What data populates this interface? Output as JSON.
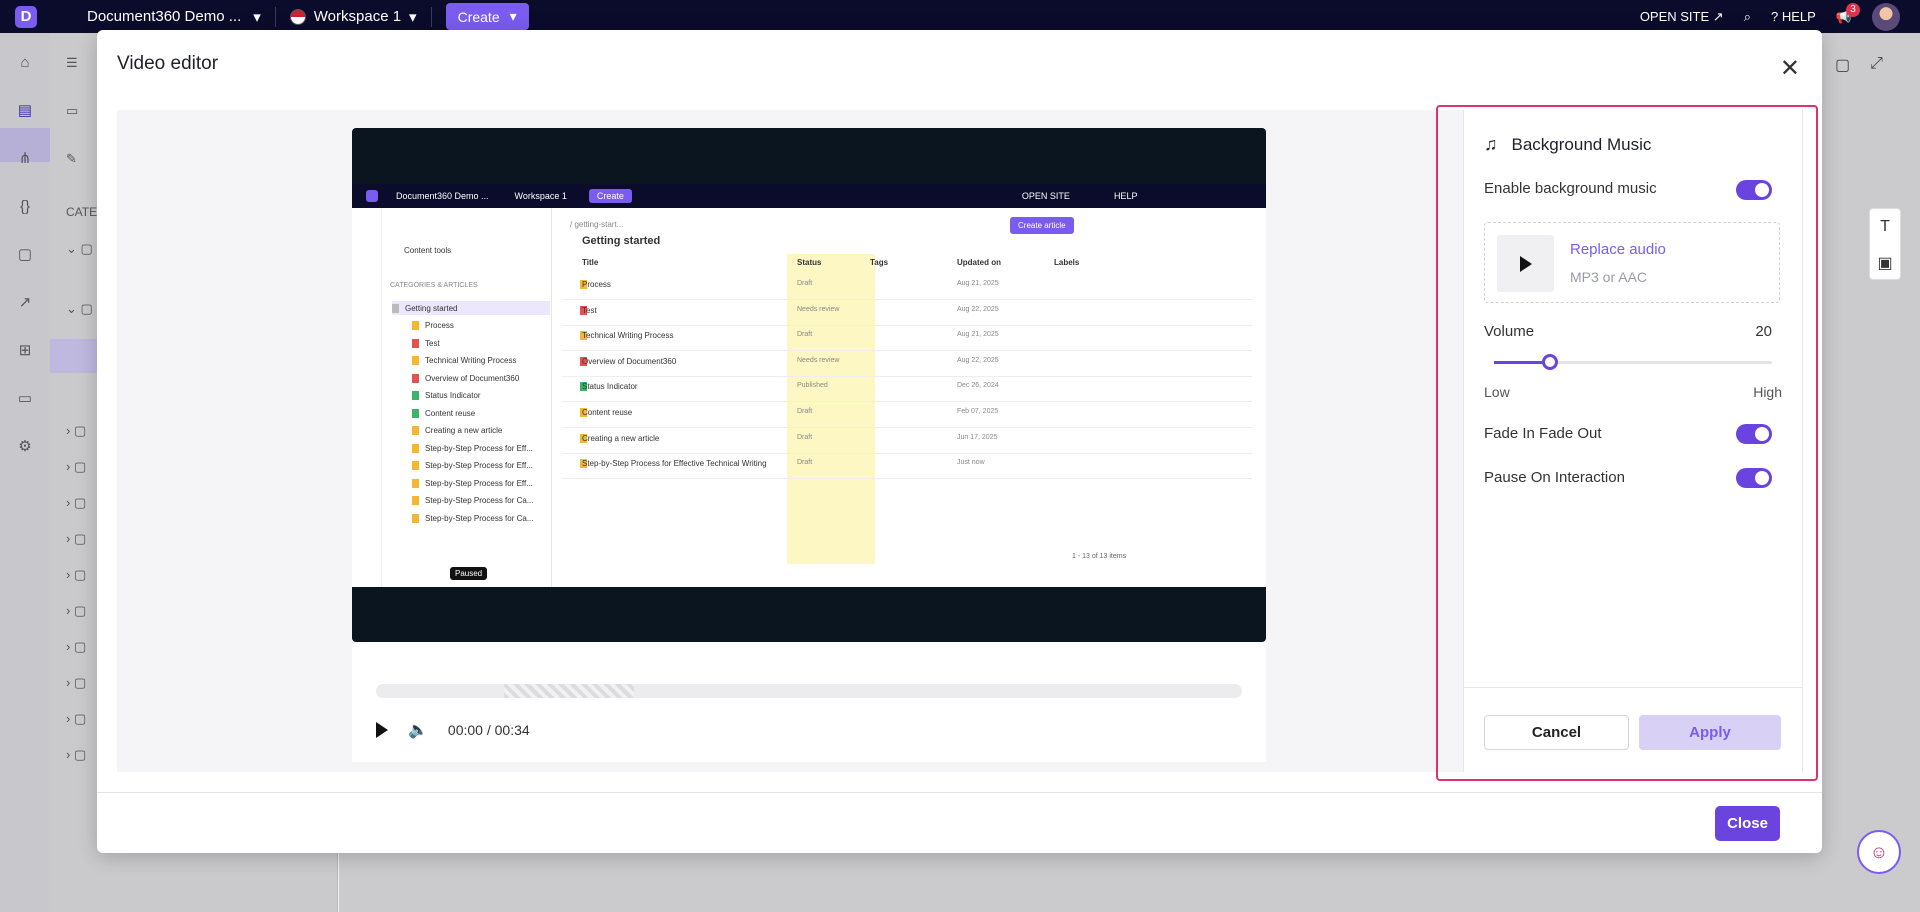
{
  "topbar": {
    "project": "Document360 Demo ...",
    "workspace": "Workspace 1",
    "create_label": "Create",
    "open_site": "OPEN SITE",
    "help": "HELP",
    "notification_count": "3"
  },
  "tree_partial": {
    "categories_label": "CATE"
  },
  "modal": {
    "title": "Video editor",
    "close_label": "Close",
    "time_display": "00:00 / 00:34"
  },
  "video_frame": {
    "project": "Document360 Demo ...",
    "workspace": "Workspace 1",
    "create": "Create",
    "open_site": "OPEN SITE",
    "help": "HELP",
    "breadcrumb": "/ getting-start...",
    "page_title": "Getting started",
    "create_article": "Create article",
    "content_tools": "Content tools",
    "categories_label": "CATEGORIES & ARTICLES",
    "tree_items": [
      {
        "label": "Getting started",
        "color": "folder"
      },
      {
        "label": "Process",
        "color": "o"
      },
      {
        "label": "Test",
        "color": "r"
      },
      {
        "label": "Technical Writing Process",
        "color": "o"
      },
      {
        "label": "Overview of Document360",
        "color": "r"
      },
      {
        "label": "Status Indicator",
        "color": "g"
      },
      {
        "label": "Content reuse",
        "color": "g"
      },
      {
        "label": "Creating a new article",
        "color": "o"
      },
      {
        "label": "Step-by-Step Process for Eff...",
        "color": "o"
      },
      {
        "label": "Step-by-Step Process for Eff...",
        "color": "o"
      },
      {
        "label": "Step-by-Step Process for Eff...",
        "color": "o"
      },
      {
        "label": "Step-by-Step Process for Ca...",
        "color": "o"
      },
      {
        "label": "Step-by-Step Process for Ca...",
        "color": "o"
      }
    ],
    "columns": [
      "Title",
      "Status",
      "Tags",
      "Updated on",
      "Labels"
    ],
    "rows": [
      {
        "title": "Process",
        "status": "Draft",
        "updated": "Aug 21, 2025",
        "color": "o"
      },
      {
        "title": "Test",
        "status": "Needs review",
        "updated": "Aug 22, 2025",
        "color": "r"
      },
      {
        "title": "Technical Writing Process",
        "status": "Draft",
        "updated": "Aug 21, 2025",
        "color": "o"
      },
      {
        "title": "Overview of Document360",
        "status": "Needs review",
        "updated": "Aug 22, 2025",
        "color": "r"
      },
      {
        "title": "Status Indicator",
        "status": "Published",
        "updated": "Dec 26, 2024",
        "color": "g"
      },
      {
        "title": "Content reuse",
        "status": "Draft",
        "updated": "Feb 07, 2025",
        "color": "o"
      },
      {
        "title": "Creating a new article",
        "status": "Draft",
        "updated": "Jun 17, 2025",
        "color": "o"
      },
      {
        "title": "Step-by-Step Process for Effective Technical Writing",
        "status": "Draft",
        "updated": "Just now",
        "color": "o"
      }
    ],
    "pagination": "1 - 13 of 13 items",
    "paused": "Paused"
  },
  "panel": {
    "title": "Background Music",
    "enable_label": "Enable background music",
    "replace_audio": "Replace audio",
    "format": "MP3 or AAC",
    "volume_label": "Volume",
    "volume_value": "20",
    "low": "Low",
    "high": "High",
    "fade_label": "Fade In Fade Out",
    "pause_label": "Pause On Interaction",
    "cancel": "Cancel",
    "apply": "Apply"
  },
  "colors": {
    "accent": "#6b44e0",
    "highlight_outline": "#e2306b"
  }
}
